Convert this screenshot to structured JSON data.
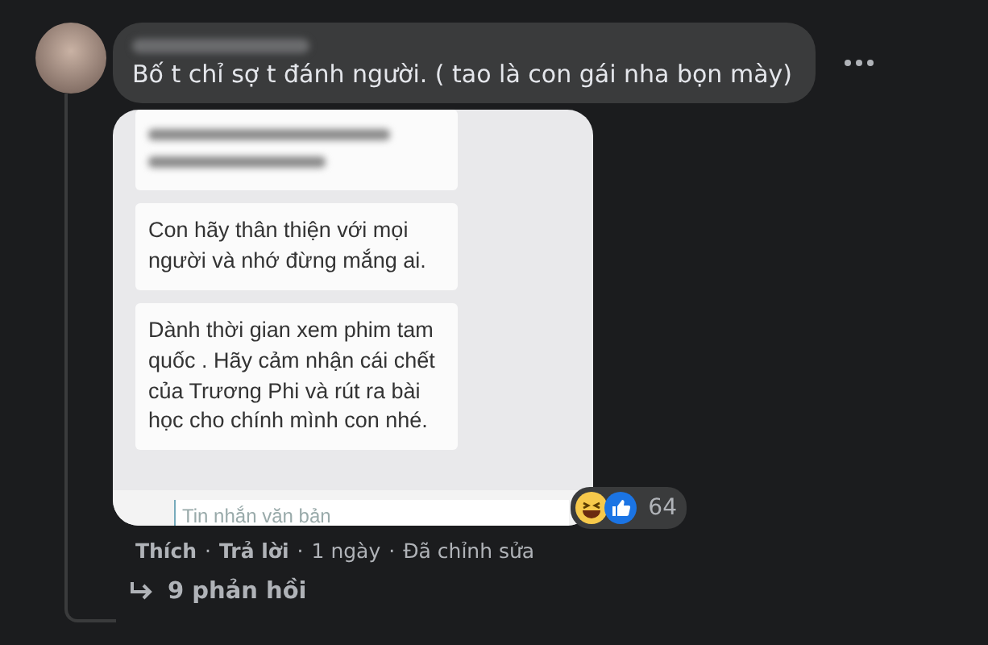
{
  "comment": {
    "text": "Bố t chỉ sợ t đánh người. ( tao là con gái nha bọn mày)",
    "image": {
      "messages": [
        {
          "kind": "blurred"
        },
        {
          "kind": "text",
          "text": "Con hãy thân thiện với mọi người và nhớ đừng mắng ai."
        },
        {
          "kind": "text",
          "text": "Dành thời gian xem phim tam quốc . Hãy cảm nhận cái chết của Trương Phi và rút ra bài học cho chính mình con nhé."
        }
      ],
      "input_placeholder": "Tin nhắn văn bản"
    },
    "reactions": {
      "count": "64"
    },
    "actions": [
      {
        "kind": "link",
        "text": "Thích"
      },
      {
        "kind": "link",
        "text": "Trả lời"
      },
      {
        "kind": "meta",
        "text": "1 ngày"
      },
      {
        "kind": "meta",
        "text": "Đã chỉnh sửa"
      }
    ],
    "separator": "·",
    "replies": "9 phản hồi"
  }
}
